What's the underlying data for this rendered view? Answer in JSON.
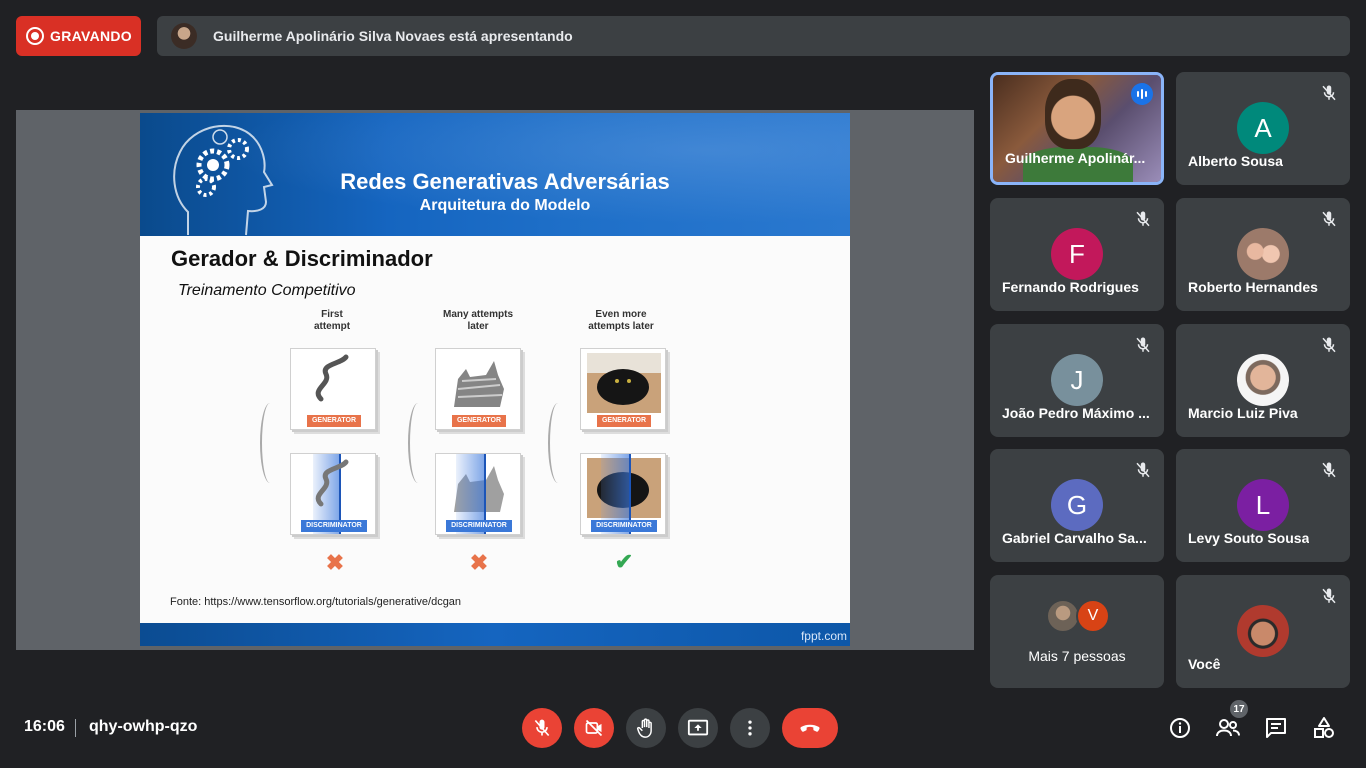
{
  "recording": {
    "label": "GRAVANDO"
  },
  "presenter_bar": {
    "text": "Guilherme Apolinário Silva Novaes está apresentando"
  },
  "slide": {
    "title": "Redes Generativas Adversárias",
    "subtitle": "Arquitetura do Modelo",
    "heading": "Gerador & Discriminador",
    "subheading": "Treinamento Competitivo",
    "columns": [
      {
        "head_line1": "First",
        "head_line2": "attempt",
        "result": "✖"
      },
      {
        "head_line1": "Many attempts",
        "head_line2": "later",
        "result": "✖"
      },
      {
        "head_line1": "Even more",
        "head_line2": "attempts later",
        "result": "✔"
      }
    ],
    "generator_tag": "GENERATOR",
    "discriminator_tag": "DISCRIMINATOR",
    "source": "Fonte: https://www.tensorflow.org/tutorials/generative/dcgan",
    "footer": "fppt.com"
  },
  "participants": [
    {
      "name": "Guilherme Apolinár...",
      "type": "video",
      "speaking": true
    },
    {
      "name": "Alberto Sousa",
      "initial": "A",
      "color": "#00897b",
      "muted": true
    },
    {
      "name": "Fernando Rodrigues",
      "initial": "F",
      "color": "#c2185b",
      "muted": true
    },
    {
      "name": "Roberto Hernandes",
      "initial": "",
      "type": "photo",
      "muted": true
    },
    {
      "name": "João Pedro Máximo ...",
      "initial": "J",
      "color": "#78909c",
      "muted": true
    },
    {
      "name": "Marcio Luiz Piva",
      "initial": "",
      "type": "photo",
      "muted": true
    },
    {
      "name": "Gabriel Carvalho Sa...",
      "initial": "G",
      "color": "#5c6bc0",
      "muted": true
    },
    {
      "name": "Levy Souto Sousa",
      "initial": "L",
      "color": "#7b1fa2",
      "muted": true
    },
    {
      "name": "Mais 7 pessoas",
      "type": "more",
      "second_initial": "V"
    },
    {
      "name": "Você",
      "type": "photo",
      "muted": true
    }
  ],
  "bottom_bar": {
    "time": "16:06",
    "meeting_code": "qhy-owhp-qzo",
    "people_count": "17"
  },
  "icons": {
    "mic": "mic-off-icon",
    "camera": "camera-off-icon",
    "hand": "raise-hand-icon",
    "present": "present-icon",
    "more": "more-options-icon",
    "end": "end-call-icon",
    "info": "info-icon",
    "people": "people-icon",
    "chat": "chat-icon",
    "activities": "activities-icon"
  }
}
